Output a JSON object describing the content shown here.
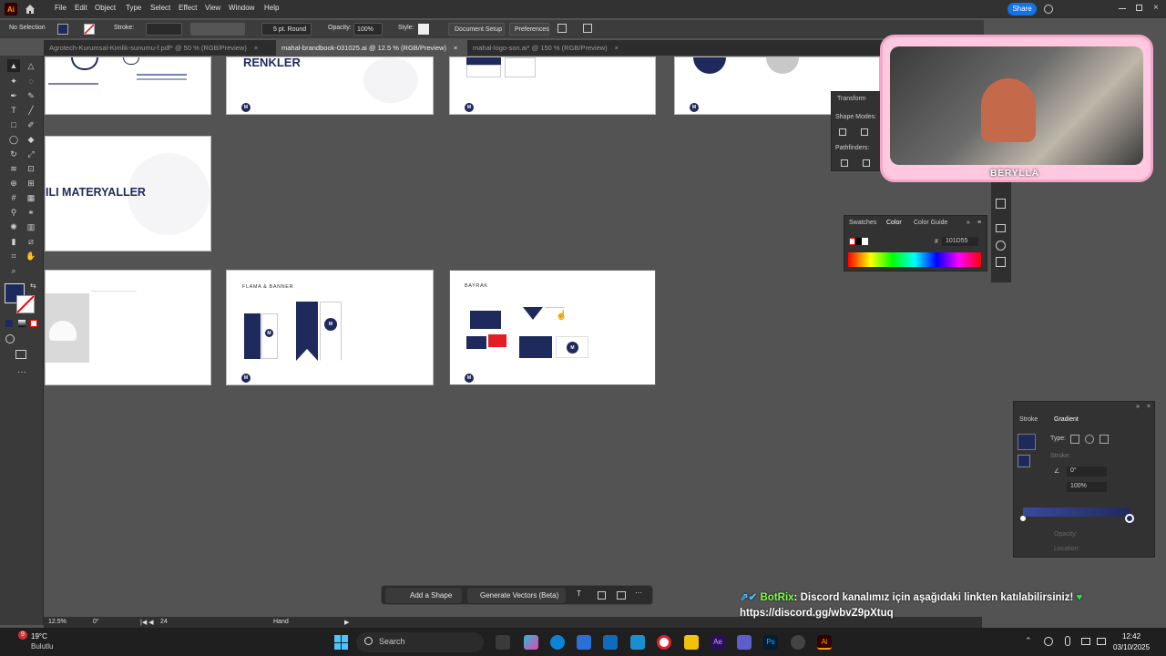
{
  "app": {
    "logo": "Ai"
  },
  "menu": [
    "File",
    "Edit",
    "Object",
    "Type",
    "Select",
    "Effect",
    "View",
    "Window",
    "Help"
  ],
  "share_label": "Share",
  "control": {
    "selection": "No Selection",
    "stroke_label": "Stroke:",
    "brush": "5 pt. Round",
    "opacity_label": "Opacity:",
    "opacity_value": "100%",
    "style_label": "Style:",
    "doc_setup": "Document Setup",
    "preferences": "Preferences"
  },
  "tabs": [
    {
      "label": "Agrotech-Kurumsal-Kimlik-sunumu-f.pdf* @ 50 % (RGB/Preview)",
      "close": "×"
    },
    {
      "label": "mahal-brandbook-031025.ai @ 12.5 % (RGB/Preview)",
      "close": "×"
    },
    {
      "label": "mahal-logo-son.ai* @ 150 % (RGB/Preview)",
      "close": "×"
    }
  ],
  "artboards": {
    "renkler_title": "RENKLER",
    "materyaller_title": "ILI MATERYALLER",
    "flama_title": "FLAMA & BANNER",
    "bayrak_title": "BAYRAK",
    "logo_letter": "M"
  },
  "transform_panel": {
    "title": "Transform",
    "shape_modes": "Shape Modes:",
    "pathfinders": "Pathfinders:"
  },
  "color_panel": {
    "tabs": [
      "Swatches",
      "Color",
      "Color Guide"
    ],
    "hash": "#",
    "hex": "101D55"
  },
  "gradient_panel": {
    "tabs": [
      "Stroke",
      "Gradient"
    ],
    "type_label": "Type:",
    "stroke_label": "Stroke:",
    "angle": "0°",
    "scale": "100%",
    "opacity_label": "Opacity:",
    "location_label": "Location:"
  },
  "bottom_float": {
    "add_shape": "Add a Shape",
    "generate": "Generate Vectors (Beta)",
    "more": "···"
  },
  "status": {
    "zoom": "12.5%",
    "rotation": "0°",
    "artboard": "24",
    "tool": "Hand"
  },
  "webcam": {
    "name": "BERYLLA"
  },
  "chat": {
    "user": "BotRix",
    "message": ": Discord kanalımız için aşağıdaki linkten katılabilirsiniz!",
    "link": "https://discord.gg/wbvZ9pXtuq"
  },
  "taskbar": {
    "weather_temp": "19°C",
    "weather_desc": "Bulutlu",
    "weather_badge": "9",
    "search_placeholder": "Search",
    "time": "12:42",
    "date": "03/10/2025"
  },
  "colors": {
    "navy": "#1f2a5c",
    "accent": "#1473e6",
    "artboard": "#ffffff"
  }
}
